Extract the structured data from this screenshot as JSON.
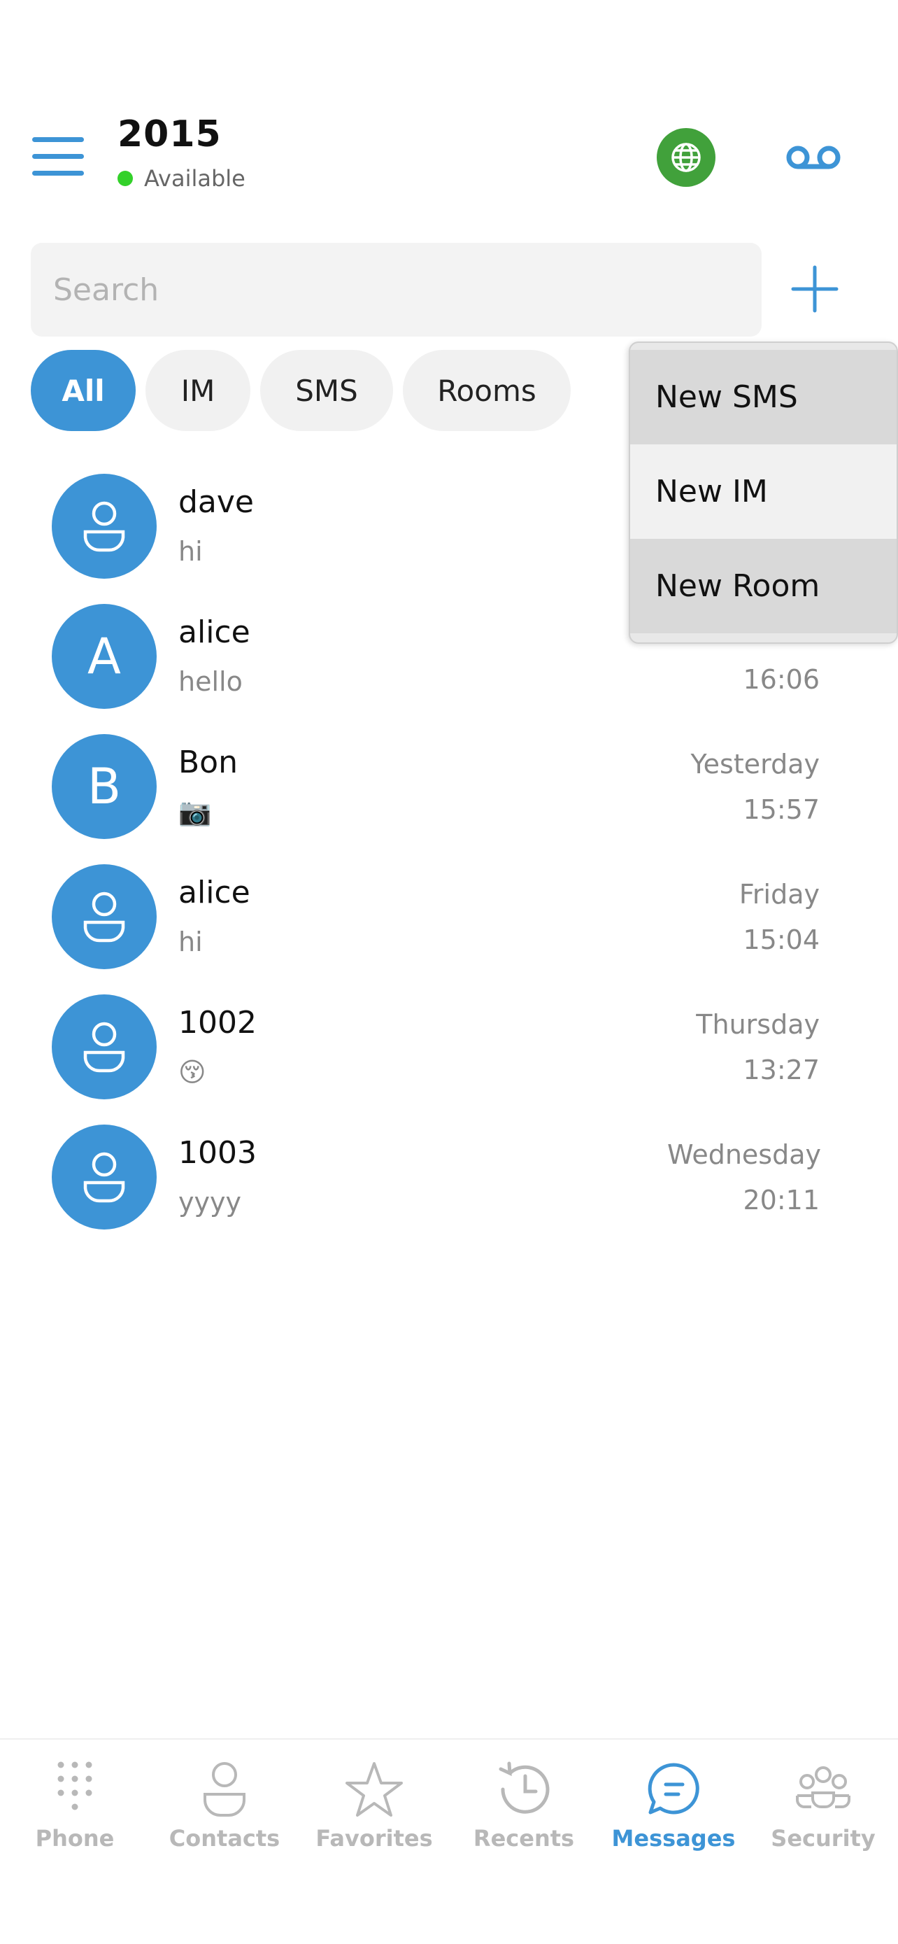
{
  "header": {
    "title": "2015",
    "status": "Available",
    "status_color": "#33d12a"
  },
  "search": {
    "placeholder": "Search",
    "value": ""
  },
  "filters": {
    "all": "All",
    "im": "IM",
    "sms": "SMS",
    "rooms": "Rooms",
    "selected": "All"
  },
  "conversations": [
    {
      "name": "dave",
      "preview": "hi",
      "avatar": "person-icon",
      "date": "",
      "time": ""
    },
    {
      "name": "alice",
      "preview": "hello",
      "avatar_letter": "A",
      "date": "",
      "time": "16:06"
    },
    {
      "name": "Bon",
      "preview": "📷",
      "avatar_letter": "B",
      "date": "Yesterday",
      "time": "15:57"
    },
    {
      "name": "alice",
      "preview": "hi",
      "avatar": "person-icon",
      "date": "Friday",
      "time": "15:04"
    },
    {
      "name": "1002",
      "preview": "😚",
      "avatar": "person-icon",
      "date": "Thursday",
      "time": "13:27"
    },
    {
      "name": "1003",
      "preview": "yyyy",
      "avatar": "person-icon",
      "date": "Wednesday",
      "time": "20:11"
    }
  ],
  "dropdown": {
    "new_sms": "New SMS",
    "new_im": "New IM",
    "new_room": "New Room"
  },
  "bottom_nav": {
    "phone": "Phone",
    "contacts": "Contacts",
    "favorites": "Favorites",
    "recents": "Recents",
    "messages": "Messages",
    "security": "Security",
    "active": "Messages"
  },
  "colors": {
    "accent": "#3d94d6",
    "globe": "#41a13b",
    "inactive": "#b8b8b8"
  }
}
